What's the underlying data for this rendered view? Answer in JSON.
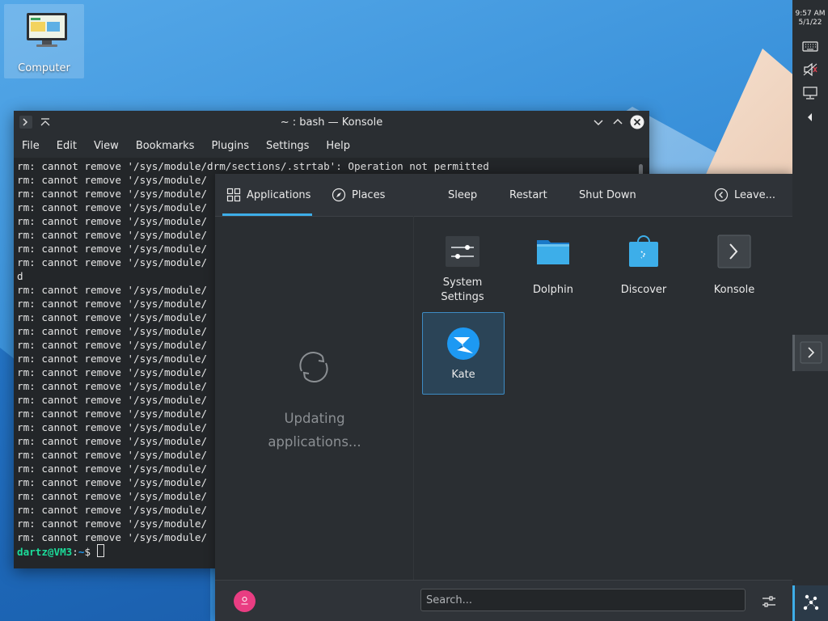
{
  "desktop": {
    "icon_label": "Computer"
  },
  "konsole": {
    "title": "~ : bash — Konsole",
    "menu": [
      "File",
      "Edit",
      "View",
      "Bookmarks",
      "Plugins",
      "Settings",
      "Help"
    ],
    "lines": [
      "rm: cannot remove '/sys/module/drm/sections/.strtab': Operation not permitted",
      "rm: cannot remove '/sys/module/",
      "rm: cannot remove '/sys/module/",
      "rm: cannot remove '/sys/module/",
      "rm: cannot remove '/sys/module/",
      "rm: cannot remove '/sys/module/",
      "rm: cannot remove '/sys/module/",
      "rm: cannot remove '/sys/module/",
      "d",
      "rm: cannot remove '/sys/module/",
      "rm: cannot remove '/sys/module/",
      "rm: cannot remove '/sys/module/",
      "rm: cannot remove '/sys/module/",
      "rm: cannot remove '/sys/module/",
      "rm: cannot remove '/sys/module/",
      "rm: cannot remove '/sys/module/",
      "rm: cannot remove '/sys/module/",
      "rm: cannot remove '/sys/module/",
      "rm: cannot remove '/sys/module/",
      "rm: cannot remove '/sys/module/",
      "rm: cannot remove '/sys/module/",
      "rm: cannot remove '/sys/module/",
      "rm: cannot remove '/sys/module/",
      "rm: cannot remove '/sys/module/",
      "rm: cannot remove '/sys/module/",
      "rm: cannot remove '/sys/module/",
      "rm: cannot remove '/sys/module/",
      "rm: cannot remove '/sys/module/"
    ],
    "prompt_user": "dartz@VM3",
    "prompt_sep": ":",
    "prompt_path": "~",
    "prompt_symbol": "$ "
  },
  "launcher": {
    "tabs": {
      "applications": "Applications",
      "places": "Places"
    },
    "power": {
      "sleep": "Sleep",
      "restart": "Restart",
      "shutdown": "Shut Down",
      "leave": "Leave..."
    },
    "status": "Updating applications...",
    "apps": [
      {
        "label": "System Settings"
      },
      {
        "label": "Dolphin"
      },
      {
        "label": "Discover"
      },
      {
        "label": "Konsole"
      },
      {
        "label": "Kate"
      }
    ],
    "search_placeholder": "Search..."
  },
  "panel": {
    "time": "9:57 AM",
    "date": "5/1/22"
  },
  "colors": {
    "accent": "#3daee9",
    "prompt_user": "#1cdc9a",
    "prompt_path": "#1d99f3",
    "avatar": "#e93d82"
  }
}
